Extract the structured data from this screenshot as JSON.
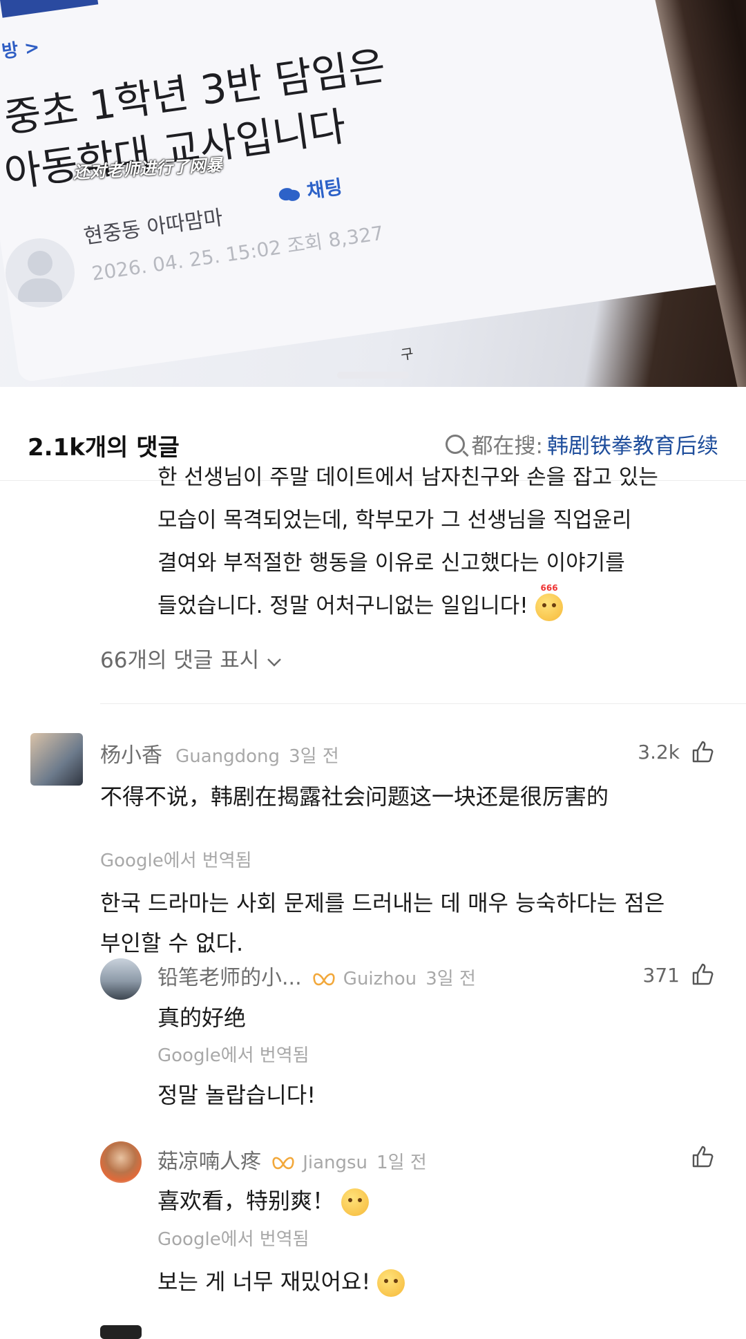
{
  "video": {
    "breadcrumb": "방 >",
    "title_line1": "중초 1학년 3반 담임은",
    "title_line2": "아동학대 교사입니다",
    "subtitle": "还对老师进行了网暴",
    "author": "현중동 아따맘마",
    "chat_label": "채팅",
    "date_views": "2026. 04. 25. 15:02 조회 8,327",
    "fragment": "구"
  },
  "comments_header": {
    "count_label": "2.1k개의 댓글",
    "search_prefix": "都在搜:",
    "search_query": "韩剧铁拳教育后续"
  },
  "prev_reply": {
    "lines": [
      "한 선생님이 주말 데이트에서 남자친구와 손을 잡고 있는",
      "모습이 목격되었는데, 학부모가 그 선생님을 직업윤리",
      "결여와 부적절한 행동을 이유로 신고했다는 이야기를",
      "들었습니다. 정말 어처구니없는 일입니다! "
    ],
    "emoji_caption": "666",
    "show_replies": "66개의 댓글 표시",
    "chevron_icon": "chevron-down-icon"
  },
  "comments": [
    {
      "name": "杨小香",
      "location": "Guangdong",
      "time": "3일 전",
      "likes": "3.2k",
      "text": "不得不说，韩剧在揭露社会问题这一块还是很厉害的",
      "translated_tag": "Google에서 번역됨",
      "translation_line1": "한국 드라마는 사회 문제를 드러내는 데 매우 능숙하다는 점은",
      "translation_line2": "부인할 수 없다."
    }
  ],
  "replies": [
    {
      "name": "铅笔老师的小...",
      "location": "Guizhou",
      "time": "3일 전",
      "likes": "371",
      "text": "真的好绝",
      "translated_tag": "Google에서 번역됨",
      "translation": "정말 놀랍습니다!"
    },
    {
      "name": "菇凉喃人疼",
      "location": "Jiangsu",
      "time": "1일 전",
      "likes": "",
      "text": "喜欢看，特别爽！",
      "translated_tag": "Google에서 번역됨",
      "translation": "보는 게 너무 재밌어요! "
    }
  ],
  "colors": {
    "accent": "#1f4e9c",
    "badge": "#f2a83b",
    "muted": "#a8a8a8"
  }
}
